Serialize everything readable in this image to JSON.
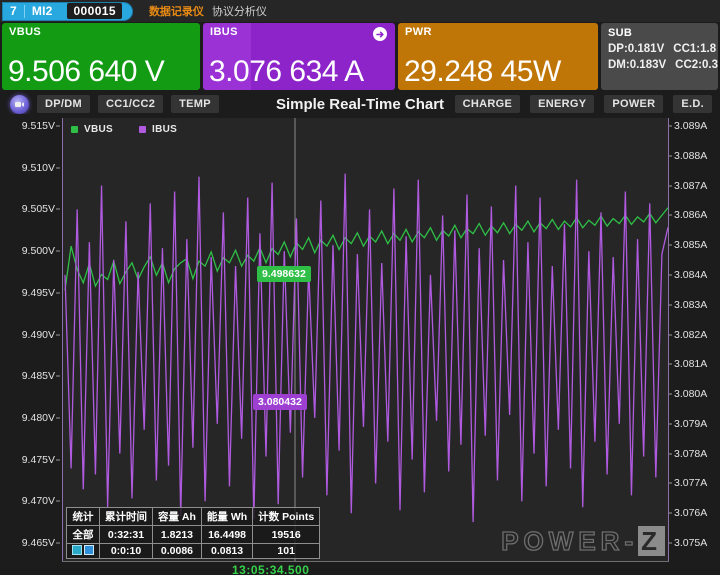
{
  "titlebar": {
    "channel": "7",
    "model": "MI2",
    "serial": "000015",
    "tab_recorder": "数据记录仪",
    "tab_protocol": "协议分析仪"
  },
  "cards": {
    "vbus": {
      "label": "VBUS",
      "value": "9.506 640 V",
      "color": "#139c13"
    },
    "ibus": {
      "label": "IBUS",
      "value": "3.076 634 A",
      "color": "#8d24c9",
      "icon": "arrow-right-circle-icon"
    },
    "pwr": {
      "label": "PWR",
      "value": "29.248 45W",
      "color": "#c07607"
    },
    "sub": {
      "label": "SUB",
      "dp": "DP:0.181V",
      "cc1": "CC1:1.8",
      "dm": "DM:0.183V",
      "cc2": "CC2:0.3"
    }
  },
  "toolbar": {
    "record_icon": "record-icon",
    "left_buttons": [
      "DP/DM",
      "CC1/CC2",
      "TEMP"
    ],
    "title": "Simple Real-Time Chart",
    "right_buttons": [
      "CHARGE",
      "ENERGY",
      "POWER",
      "E.D."
    ]
  },
  "chart_data": {
    "type": "line",
    "title": "Simple Real-Time Chart",
    "xlabel": "",
    "grid": false,
    "legend_position": "top-left",
    "legend": [
      "VBUS",
      "IBUS"
    ],
    "y_left": {
      "label": "VBUS",
      "unit": "V",
      "color": "#2fbf46",
      "ylim": [
        9.465,
        9.515
      ],
      "ticks": [
        "9.515V",
        "9.510V",
        "9.505V",
        "9.500V",
        "9.495V",
        "9.490V",
        "9.485V",
        "9.480V",
        "9.475V",
        "9.470V",
        "9.465V"
      ]
    },
    "y_right": {
      "label": "IBUS",
      "unit": "A",
      "color": "#b05ae0",
      "ylim": [
        3.075,
        3.089
      ],
      "ticks": [
        "3.089A",
        "3.088A",
        "3.087A",
        "3.086A",
        "3.085A",
        "3.084A",
        "3.083A",
        "3.082A",
        "3.081A",
        "3.080A",
        "3.079A",
        "3.078A",
        "3.077A",
        "3.076A",
        "3.075A"
      ]
    },
    "cursor_labels": {
      "vbus": "9.498632",
      "ibus": "3.080432"
    },
    "series": [
      {
        "name": "VBUS",
        "axis": "left",
        "color": "#2fbf46",
        "values": [
          9.4953,
          9.5006,
          9.4978,
          9.4962,
          9.4985,
          9.4958,
          9.4972,
          9.4966,
          9.4988,
          9.4961,
          9.4975,
          9.4986,
          9.4966,
          9.4981,
          9.4993,
          9.4971,
          9.4986,
          9.4962,
          9.4979,
          9.4986,
          9.4991,
          9.4967,
          9.4988,
          9.4982,
          9.4999,
          9.4976,
          9.4992,
          9.4986,
          9.5001,
          9.4982,
          9.4995,
          9.4988,
          9.5004,
          9.4986,
          9.5003,
          9.4996,
          9.5011,
          9.4993,
          9.501,
          9.5002,
          9.5016,
          9.4998,
          9.5013,
          9.5006,
          9.5019,
          9.5002,
          9.5016,
          9.5009,
          9.5022,
          9.5006,
          9.5018,
          9.5011,
          9.5024,
          9.5009,
          9.5021,
          9.5013,
          9.5026,
          9.5011,
          9.5023,
          9.5016,
          9.5028,
          9.5013,
          9.5025,
          9.5018,
          9.5031,
          9.5016,
          9.5027,
          9.5021,
          9.5033,
          9.5019,
          9.503,
          9.5022,
          9.5034,
          9.5021,
          9.5032,
          9.5025,
          9.5036,
          9.5023,
          9.5034,
          9.5027,
          9.5038,
          9.5026,
          9.5036,
          9.5029,
          9.504,
          9.5028,
          9.5037,
          9.5031,
          9.5042,
          9.503,
          9.5039,
          9.5033,
          9.5043,
          9.5032,
          9.5041,
          9.5035,
          9.5045,
          9.5034,
          9.5043,
          9.5052
        ]
      },
      {
        "name": "IBUS",
        "axis": "right",
        "color": "#b05ae0",
        "values": [
          3.084,
          3.0775,
          3.0862,
          3.0768,
          3.0851,
          3.0773,
          3.087,
          3.0762,
          3.0845,
          3.078,
          3.0858,
          3.0765,
          3.0841,
          3.0788,
          3.0864,
          3.0771,
          3.0849,
          3.0776,
          3.0868,
          3.0759,
          3.0852,
          3.0782,
          3.0873,
          3.0764,
          3.0846,
          3.079,
          3.0861,
          3.0769,
          3.0843,
          3.0785,
          3.0866,
          3.0758,
          3.0854,
          3.0779,
          3.0871,
          3.0763,
          3.0848,
          3.0787,
          3.0859,
          3.0772,
          3.0842,
          3.0792,
          3.0865,
          3.0766,
          3.085,
          3.0781,
          3.0874,
          3.076,
          3.0847,
          3.0789,
          3.0862,
          3.077,
          3.0844,
          3.0784,
          3.0869,
          3.0761,
          3.0853,
          3.0778,
          3.0872,
          3.0767,
          3.084,
          3.0791,
          3.086,
          3.0774,
          3.0855,
          3.0783,
          3.0867,
          3.0757,
          3.0849,
          3.0786,
          3.0863,
          3.0771,
          3.0845,
          3.0793,
          3.087,
          3.0764,
          3.0851,
          3.078,
          3.0866,
          3.0769,
          3.0843,
          3.0788,
          3.0857,
          3.0775,
          3.0872,
          3.0762,
          3.0848,
          3.0784,
          3.0861,
          3.0773,
          3.0846,
          3.079,
          3.0868,
          3.0766,
          3.0852,
          3.0779,
          3.0864,
          3.0772,
          3.0847,
          3.0856
        ]
      }
    ]
  },
  "stats_table": {
    "headers": [
      "统计",
      "累计时间",
      "容量 Ah",
      "能量 Wh",
      "计数 Points"
    ],
    "rows": [
      {
        "name": "全部",
        "time": "0:32:31",
        "capacity": "1.8213",
        "energy": "16.4498",
        "points": "19516"
      },
      {
        "name": "",
        "time": "0:0:10",
        "capacity": "0.0086",
        "energy": "0.0813",
        "points": "101"
      }
    ]
  },
  "watermark": {
    "text": "POWER-",
    "z": "Z"
  },
  "timestamp": "13:05:34.500"
}
